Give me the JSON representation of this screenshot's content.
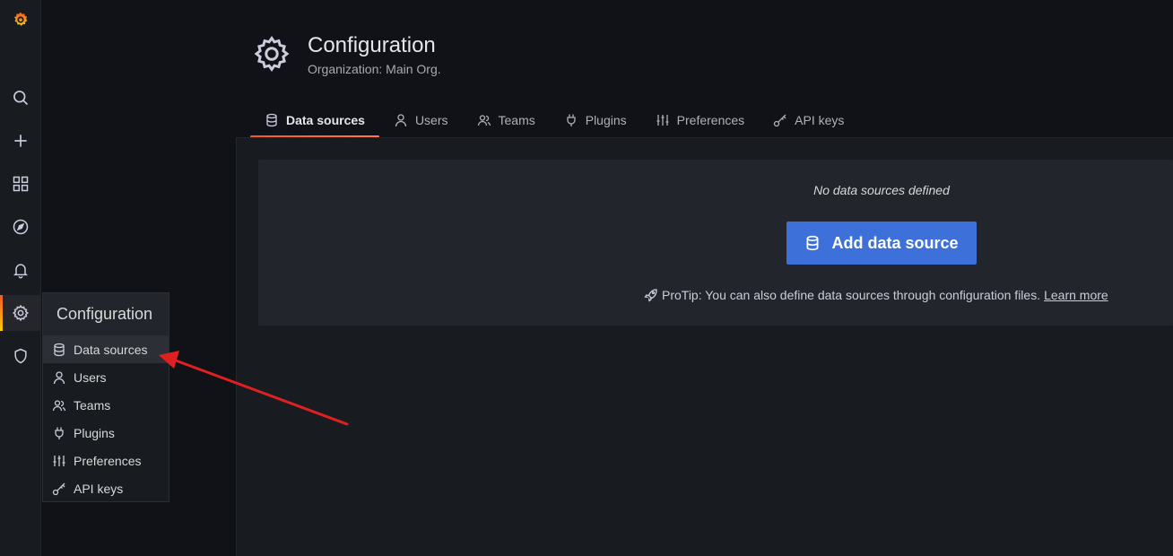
{
  "sidenav": {
    "items": [
      {
        "icon": "grafana-logo-icon"
      },
      {
        "icon": "search-icon"
      },
      {
        "icon": "plus-icon"
      },
      {
        "icon": "dashboards-icon"
      },
      {
        "icon": "compass-icon"
      },
      {
        "icon": "bell-icon"
      },
      {
        "icon": "gear-icon",
        "active": true
      },
      {
        "icon": "shield-icon"
      }
    ]
  },
  "flyout": {
    "title": "Configuration",
    "items": [
      {
        "label": "Data sources",
        "icon": "database-icon",
        "active": true
      },
      {
        "label": "Users",
        "icon": "user-icon"
      },
      {
        "label": "Teams",
        "icon": "users-icon"
      },
      {
        "label": "Plugins",
        "icon": "plug-icon"
      },
      {
        "label": "Preferences",
        "icon": "sliders-icon"
      },
      {
        "label": "API keys",
        "icon": "key-icon"
      }
    ]
  },
  "header": {
    "title": "Configuration",
    "subtitle": "Organization: Main Org."
  },
  "tabs": [
    {
      "label": "Data sources",
      "icon": "database-icon",
      "active": true
    },
    {
      "label": "Users",
      "icon": "user-icon"
    },
    {
      "label": "Teams",
      "icon": "users-icon"
    },
    {
      "label": "Plugins",
      "icon": "plug-icon"
    },
    {
      "label": "Preferences",
      "icon": "sliders-icon"
    },
    {
      "label": "API keys",
      "icon": "key-icon"
    }
  ],
  "empty_state": {
    "title": "No data sources defined",
    "button_label": "Add data source",
    "protip_text": "ProTip: You can also define data sources through configuration files.",
    "protip_link": "Learn more"
  },
  "colors": {
    "accent": "#f05a28",
    "primary_button": "#3d71d9",
    "annotation_arrow": "#e02020"
  }
}
